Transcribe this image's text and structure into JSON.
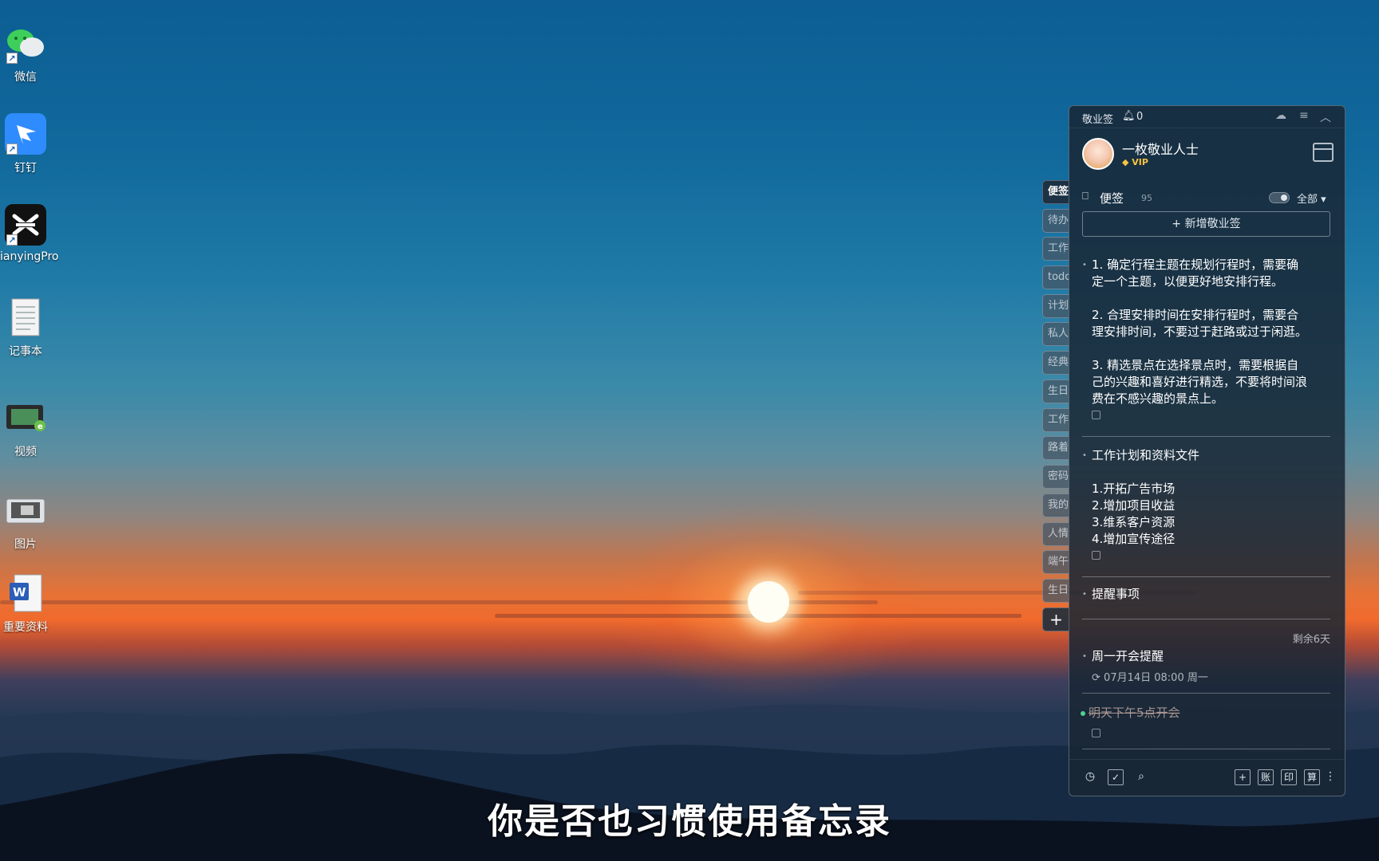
{
  "desktop": {
    "icons": [
      {
        "label": "微信",
        "icon": "wechat-icon"
      },
      {
        "label": "钉钉",
        "icon": "dingtalk-icon"
      },
      {
        "label": "ianyingPro",
        "icon": "jianying-icon"
      },
      {
        "label": "记事本",
        "icon": "notepad-icon"
      },
      {
        "label": "视频",
        "icon": "video-folder-icon"
      },
      {
        "label": "图片",
        "icon": "picture-folder-icon"
      },
      {
        "label": "重要资料",
        "icon": "word-document-icon"
      }
    ]
  },
  "side_tabs": [
    "便签",
    "待办",
    "工作",
    "todo",
    "计划",
    "私人",
    "经典",
    "生日",
    "工作",
    "路着",
    "密码",
    "我的",
    "人情",
    "端午",
    "生日"
  ],
  "widget": {
    "title": "敬业签",
    "bell_count": "0",
    "user": {
      "name": "一枚敬业人士",
      "badge": "VIP"
    },
    "section": {
      "label": "便签",
      "count": "95",
      "filter": "全部"
    },
    "new_note_label": "+ 新增敬业签",
    "notes": [
      {
        "text": "1. 确定行程主题在规划行程时，需要确\n定一个主题，以便更好地安排行程。\n\n2. 合理安排时间在安排行程时，需要合\n理安排时间，不要过于赶路或过于闲逛。\n\n3. 精选景点在选择景点时，需要根据自\n己的兴趣和喜好进行精选，不要将时间浪\n费在不感兴趣的景点上。"
      },
      {
        "text": "工作计划和资料文件\n\n1.开拓广告市场\n2.增加项目收益\n3.维系客户资源\n4.增加宣传途径"
      },
      {
        "text": "提醒事项"
      }
    ],
    "reminder": {
      "remaining": "剩余6天",
      "title": "周一开会提醒",
      "datetime": "07月14日 08:00 周一"
    },
    "done_task": "明天下午5点开会",
    "footer": {
      "left_icons": [
        "clock-icon",
        "checkbox-icon",
        "search-icon"
      ],
      "right_buttons": [
        "+",
        "账",
        "印",
        "算"
      ]
    }
  },
  "subtitle": "你是否也习惯使用备忘录",
  "colors": {
    "panel_bg": "#18263a",
    "accent_green": "#4fd18b",
    "vip_gold": "#f6c343"
  }
}
